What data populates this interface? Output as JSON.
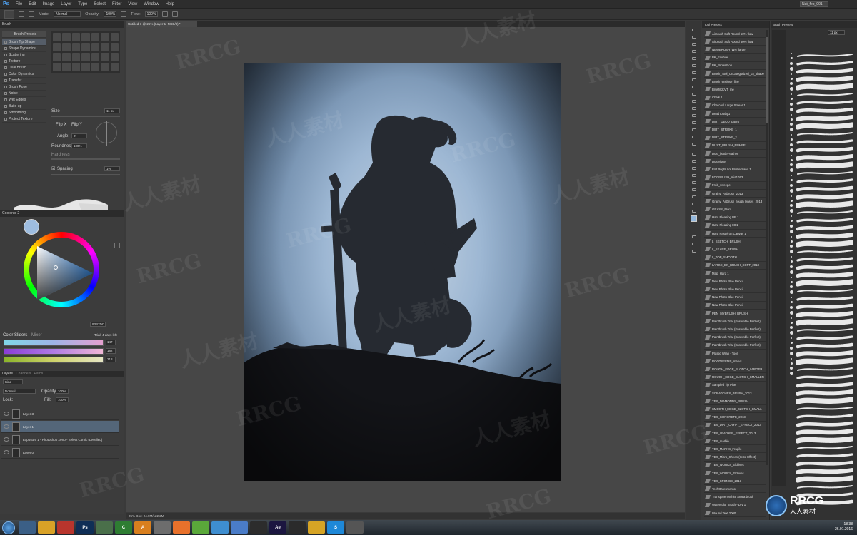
{
  "menubar": {
    "logo": "Ps",
    "items": [
      "File",
      "Edit",
      "Image",
      "Layer",
      "Type",
      "Select",
      "Filter",
      "View",
      "Window",
      "Help"
    ],
    "workspace": "Nat_feb_001"
  },
  "options": {
    "mode_label": "Mode:",
    "mode_value": "Normal",
    "opacity_label": "Opacity:",
    "opacity_value": "100%",
    "flow_label": "Flow:",
    "flow_value": "100%"
  },
  "brush_panel": {
    "tab": "Brush",
    "presets_button": "Brush Presets",
    "list": [
      {
        "label": "Brush Tip Shape",
        "sel": true
      },
      {
        "label": "Shape Dynamics",
        "sel": false
      },
      {
        "label": "Scattering",
        "sel": false
      },
      {
        "label": "Texture",
        "sel": false
      },
      {
        "label": "Dual Brush",
        "sel": false
      },
      {
        "label": "Color Dynamics",
        "sel": false
      },
      {
        "label": "Transfer",
        "sel": false
      },
      {
        "label": "Brush Pose",
        "sel": false
      },
      {
        "label": "Noise",
        "sel": false
      },
      {
        "label": "Wet Edges",
        "sel": false
      },
      {
        "label": "Build-up",
        "sel": false
      },
      {
        "label": "Smoothing",
        "sel": false
      },
      {
        "label": "Protect Texture",
        "sel": false
      }
    ],
    "size_label": "Size",
    "size_value": "11 px",
    "flip_x": "Flip X",
    "flip_y": "Flip Y",
    "angle_label": "Angle:",
    "angle_value": "0°",
    "roundness_label": "Roundness:",
    "roundness_value": "100%",
    "hardness_label": "Hardness",
    "spacing_label": "Spacing",
    "spacing_value": "1%"
  },
  "color_panel": {
    "tab": "Coolorus 2",
    "hex": "93B7DC",
    "sliders_tab": "Color Sliders",
    "mixer_tab": "Mixer",
    "trial_text": "Trial: 4 days left",
    "values": [
      "147",
      "182",
      "218"
    ],
    "colors": {
      "swatch": "#9ebde0",
      "fg": "#93b7dc"
    }
  },
  "layers_panel": {
    "tabs": [
      "Layers",
      "Channels",
      "Paths"
    ],
    "kind_label": "Kind",
    "blend_mode": "Normal",
    "opacity_label": "Opacity:",
    "opacity_value": "100%",
    "lock_label": "Lock:",
    "fill_label": "Fill:",
    "fill_value": "100%",
    "layers": [
      {
        "name": "Layer 3",
        "sel": false
      },
      {
        "name": "Layer 1",
        "sel": true
      },
      {
        "name": "Exposure 1 - Photoshop Zeno - Select Comic (Levelled)",
        "sel": false
      },
      {
        "name": "Layer 0",
        "sel": false
      }
    ]
  },
  "document": {
    "tab": "Untitled-1 @ 25% (Layer 1, RGB/8) *",
    "status": "25%      Doc: 24.9M/122.2M"
  },
  "brush_presets_panel": {
    "tab": "Tool Presets",
    "items": [
      "Airbrush Soft Round 50% flow",
      "Airbrush Soft Round 50% flow",
      "NEWBRUSH_WN_large",
      "BK_Fairhile",
      "BK_BrownRoo",
      "Brush_Tool_Uncategorized_03_shape",
      "Brush_enclose_fine",
      "BrushKKVT_me",
      "Chalk 1",
      "Charcoal Large Smear 1",
      "DeadToothy1",
      "DIRT_DECO_pacru",
      "DIRT_STROKE_1",
      "DIRT_STROKE_2",
      "DUST_BRUSH_ENMBE",
      "Dust_bottleFeather",
      "Dustyiquy",
      "Flat Bright Lot Bristle Sand 1",
      "FOGBRUSH_mia1053",
      "Fruit_sweeper",
      "Grainy_Artbrush_2013",
      "Grainy_Artbrush_rough lenses_2013",
      "GRASS_Flora",
      "Hard Pleasing BB 1",
      "Hard Pleasing 88 1",
      "Hard Pastel on Canvas 1",
      "L_SKETCH_BRUSH",
      "L_SKARE_BRUSH",
      "L_TOP_SMOOTH",
      "LARGE_BK_BRUSH_SOFT_2013",
      "Map_Hard 1",
      "New Photo Blue Pencil",
      "New Photo Blue Pencil",
      "New Photo Blue Pencil",
      "New Photo Blue Pencil",
      "PEN_MYBRUSH_BRUSH",
      "Paintbrush Trial (Ensemble Perfect)",
      "Paintbrush Trial (Ensemble Perfect)",
      "Paintbrush Trial (Ensemble Perfect)",
      "Paintbrush Trial (Ensemble Perfect)",
      "Plastic Wrap - Tool",
      "ROOTSEEMS_marvs",
      "ROUGH_EDGE_BLOTCH_LARGER",
      "ROUGH_EDGE_BLOTCH_SMALLER",
      "Sampled Tip Pixel",
      "SCRATCHES_BRUSH_2013",
      "TEX_DIAMONDS_BRUSH",
      "SMOOTH_EDGE_BLOTCH_SMALL",
      "TEX_CONCRETE_2013",
      "TEX_DIRT_CRYPT_EFFECT_2013",
      "TEX_LEATHER_EFFECT_2013",
      "TEX_marble",
      "TEX_MARKS_Fragile",
      "TEX_Micro_Sheen (Inste Effect)",
      "TEX_WORKS_Eldrives",
      "TEX_WORKS_Eldrives",
      "TEX_SPONGE_2013",
      "TechOMesmentor",
      "TransparentWhite Smea brush",
      "Watercolor Brush - Dry 1",
      "Wound Text 2000"
    ]
  },
  "stroke_panel": {
    "tab": "Brush Presets",
    "size_value": "11 px"
  },
  "taskbar": {
    "apps": [
      {
        "label": "",
        "color": "#3b5f86"
      },
      {
        "label": "",
        "color": "#d9a227"
      },
      {
        "label": "",
        "color": "#b8352d"
      },
      {
        "label": "Ps",
        "color": "#0f2e56"
      },
      {
        "label": "",
        "color": "#4a6f4a"
      },
      {
        "label": "C",
        "color": "#2e7d32"
      },
      {
        "label": "A",
        "color": "#d97f1e"
      },
      {
        "label": "",
        "color": "#6d6d6d"
      },
      {
        "label": "",
        "color": "#e8712b"
      },
      {
        "label": "",
        "color": "#5aa83a"
      },
      {
        "label": "",
        "color": "#3e8ed0"
      },
      {
        "label": "",
        "color": "#4a7cc8"
      },
      {
        "label": "",
        "color": "#2c2c2c"
      },
      {
        "label": "Ae",
        "color": "#1b1640"
      },
      {
        "label": "",
        "color": "#2b2b2b"
      },
      {
        "label": "",
        "color": "#d6a425"
      },
      {
        "label": "S",
        "color": "#1e88d8"
      },
      {
        "label": "",
        "color": "#555555"
      }
    ],
    "time": "18:38",
    "date": "26.01.2016"
  },
  "watermarks": [
    "RRCG",
    "人人素材"
  ],
  "corner_logo": {
    "main": "RRCG",
    "sub": "人人素材"
  }
}
